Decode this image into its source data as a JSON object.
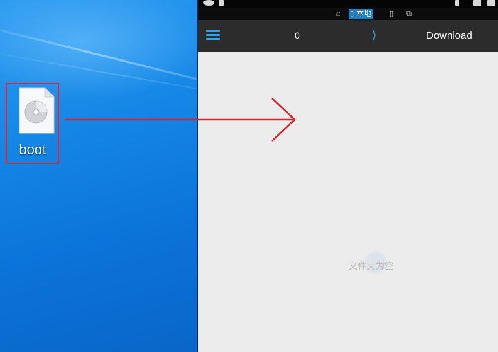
{
  "desktop": {
    "file_icon": {
      "label": "boot",
      "icon": "disc-image-file-icon"
    },
    "highlight_color": "#e0242c"
  },
  "phone": {
    "storage_tabs": [
      {
        "label": "",
        "icon": "home-icon"
      },
      {
        "label": "本地",
        "icon": "phone-icon",
        "active": true
      },
      {
        "label": "",
        "icon": "tablet-icon"
      },
      {
        "label": "",
        "icon": "network-devices-icon"
      }
    ],
    "toolbar": {
      "menu_icon": "hamburger-menu-icon",
      "count": "0",
      "separator": "⟩",
      "current_folder": "Download"
    },
    "empty_message": "文件夹为空",
    "accent_color": "#2aa5e8"
  },
  "annotation": {
    "type": "drag-arrow",
    "color": "#d8232a"
  }
}
